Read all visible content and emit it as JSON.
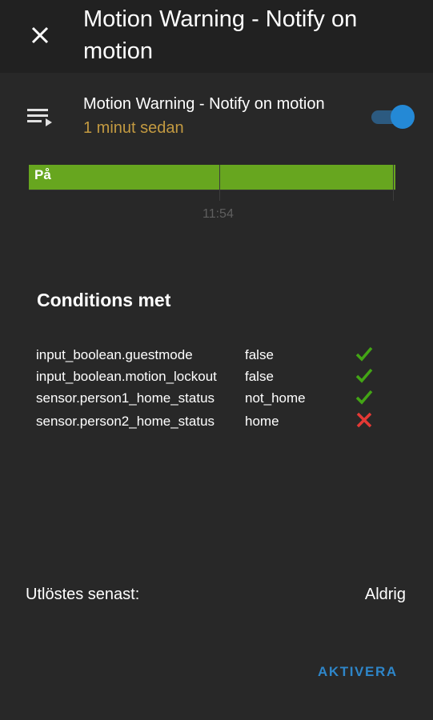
{
  "header": {
    "title": "Motion Warning - Notify on motion",
    "close_icon": "close-icon"
  },
  "entity": {
    "name": "Motion Warning - Notify on motion",
    "last_changed": "1 minut sedan",
    "icon": "playlist-play-icon",
    "toggle_on": true,
    "accent_color": "#2489d6",
    "time_color": "#c39a41"
  },
  "history": {
    "state_label": "På",
    "time_label": "11:54",
    "bar_color": "#67a61f"
  },
  "conditions": {
    "title": "Conditions met",
    "rows": [
      {
        "entity": "input_boolean.guestmode",
        "value": "false",
        "met": true
      },
      {
        "entity": "input_boolean.motion_lockout",
        "value": "false",
        "met": true
      },
      {
        "entity": "sensor.person1_home_status",
        "value": "not_home",
        "met": true
      },
      {
        "entity": "sensor.person2_home_status",
        "value": "home",
        "met": false
      }
    ],
    "met_color": "#43a515",
    "not_met_color": "#e53935"
  },
  "last_triggered": {
    "label": "Utlöstes senast:",
    "value": "Aldrig"
  },
  "actions": {
    "activate_label": "AKTIVERA"
  }
}
